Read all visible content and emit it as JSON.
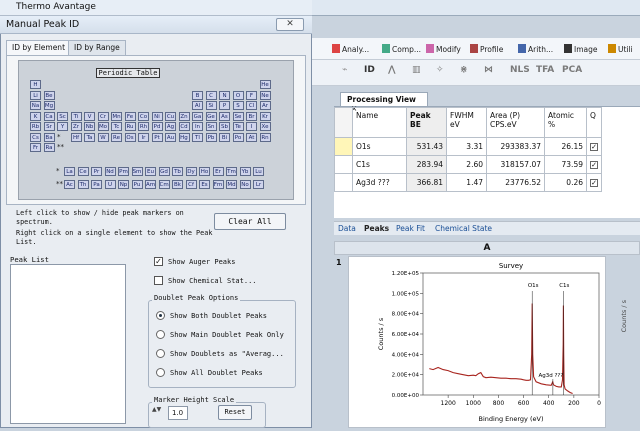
{
  "app": {
    "title": "Thermo Avantage"
  },
  "toolbar": {
    "items": [
      "Analy...",
      "Comp...",
      "Modify",
      "Profile",
      "Arith...",
      "Image",
      "Utili"
    ],
    "icons2": [
      "ID",
      "NLS",
      "TFA",
      "PCA"
    ]
  },
  "processing_view": {
    "tab_label": "Processing View",
    "close": "×",
    "columns": [
      "Name",
      "Peak BE",
      "FWHM eV",
      "Area (P) CPS.eV",
      "Atomic %",
      "Q"
    ],
    "rows": [
      {
        "name": "O1s",
        "be": "531.43",
        "fwhm": "3.31",
        "area": "293383.37",
        "atomic": "26.15",
        "q": "✓"
      },
      {
        "name": "C1s",
        "be": "283.94",
        "fwhm": "2.60",
        "area": "318157.07",
        "atomic": "73.59",
        "q": "✓"
      },
      {
        "name": "Ag3d ???",
        "be": "366.81",
        "fwhm": "1.47",
        "area": "23776.52",
        "atomic": "0.26",
        "q": "✓"
      }
    ],
    "bottom_tabs": [
      "Data",
      "Peaks",
      "Peak Fit",
      "Chemical State"
    ],
    "grid_col": "A",
    "grid_row": "1",
    "side_label": "Counts / s"
  },
  "dialog": {
    "title": "Manual Peak ID",
    "close": "✕",
    "tabs": [
      "ID by Element",
      "ID by Range"
    ],
    "pt_label": "Periodic Table",
    "help1": "Left click to show / hide peak markers on spectrum.",
    "help2": "Right click on a single element to show the Peak List.",
    "clear_all": "Clear All",
    "peak_list_label": "Peak List",
    "show_auger": "Show Auger Peaks",
    "show_auger_checked": "✓",
    "show_chemical": "Show Chemical Stat...",
    "doublet_title": "Doublet Peak Options",
    "doublet_options": [
      "Show Both Doublet Peaks",
      "Show Main Doublet Peak Only",
      "Show Doublets as \"Averag...",
      "Show All Doublet Peaks"
    ],
    "doublet_selected": 0,
    "marker_title": "Marker Height Scale",
    "marker_value": "1.0",
    "spin": "▲▼",
    "reset": "Reset"
  },
  "periodic_table": {
    "rows": [
      [
        "H",
        "",
        "",
        "",
        "",
        "",
        "",
        "",
        "",
        "",
        "",
        "",
        "",
        "",
        "",
        "",
        "",
        "He"
      ],
      [
        "Li",
        "Be",
        "",
        "",
        "",
        "",
        "",
        "",
        "",
        "",
        "",
        "",
        "B",
        "C",
        "N",
        "O",
        "F",
        "Ne"
      ],
      [
        "Na",
        "Mg",
        "",
        "",
        "",
        "",
        "",
        "",
        "",
        "",
        "",
        "",
        "Al",
        "Si",
        "P",
        "S",
        "Cl",
        "Ar"
      ],
      [
        "K",
        "Ca",
        "Sc",
        "Ti",
        "V",
        "Cr",
        "Mn",
        "Fe",
        "Co",
        "Ni",
        "Cu",
        "Zn",
        "Ga",
        "Ge",
        "As",
        "Se",
        "Br",
        "Kr"
      ],
      [
        "Rb",
        "Sr",
        "Y",
        "Zr",
        "Nb",
        "Mo",
        "Tc",
        "Ru",
        "Rh",
        "Pd",
        "Ag",
        "Cd",
        "In",
        "Sn",
        "Sb",
        "Te",
        "I",
        "Xe"
      ],
      [
        "Cs",
        "Ba",
        "*",
        "Hf",
        "Ta",
        "W",
        "Re",
        "Os",
        "Ir",
        "Pt",
        "Au",
        "Hg",
        "Tl",
        "Pb",
        "Bi",
        "Po",
        "At",
        "Rn"
      ],
      [
        "Fr",
        "Ra",
        "**",
        "",
        "",
        "",
        "",
        "",
        "",
        "",
        "",
        "",
        "",
        "",
        "",
        "",
        "",
        ""
      ]
    ],
    "lanthanides": [
      "La",
      "Ce",
      "Pr",
      "Nd",
      "Pm",
      "Sm",
      "Eu",
      "Gd",
      "Tb",
      "Dy",
      "Ho",
      "Er",
      "Tm",
      "Yb",
      "Lu"
    ],
    "actinides": [
      "Ac",
      "Th",
      "Pa",
      "U",
      "Np",
      "Pu",
      "Am",
      "Cm",
      "Bk",
      "Cf",
      "Es",
      "Fm",
      "Md",
      "No",
      "Lr"
    ],
    "star1": "*",
    "star2": "**"
  },
  "chart_data": {
    "type": "line",
    "title": "Survey",
    "xlabel": "Binding Energy (eV)",
    "ylabel": "Counts / s",
    "xlim": [
      1400,
      0
    ],
    "ylim": [
      0,
      120000
    ],
    "xticks": [
      1200,
      1000,
      800,
      600,
      400,
      200,
      0
    ],
    "yticks": [
      "0.00E+00",
      "2.00E+04",
      "4.00E+04",
      "6.00E+04",
      "8.00E+04",
      "1.00E+05",
      "1.20E+05"
    ],
    "ytick_values": [
      0,
      20000,
      40000,
      60000,
      80000,
      100000,
      120000
    ],
    "series": [
      {
        "x": [
          1350,
          1320,
          1280,
          1240,
          1200,
          1160,
          1120,
          1080,
          1040,
          1000,
          980,
          960,
          940,
          920,
          900,
          860,
          820,
          780,
          740,
          700,
          660,
          620,
          600,
          580,
          560,
          545,
          535,
          531,
          527,
          520,
          500,
          460,
          420,
          380,
          368,
          362,
          340,
          320,
          300,
          290,
          285,
          283,
          281,
          278,
          270,
          250,
          230,
          210
        ],
        "y": [
          26000,
          25000,
          27000,
          25000,
          24000,
          22000,
          21000,
          20000,
          19000,
          19500,
          19000,
          21000,
          22000,
          18000,
          17000,
          17500,
          17000,
          16500,
          16500,
          16000,
          16000,
          15500,
          15000,
          14500,
          14500,
          15000,
          40000,
          90000,
          40000,
          18000,
          13000,
          11000,
          10000,
          9500,
          13000,
          10000,
          8500,
          8000,
          8000,
          15000,
          50000,
          88000,
          40000,
          10000,
          6000,
          4000,
          2500,
          1500
        ]
      }
    ],
    "annotations": [
      "O1s",
      "C1s",
      "Ag3d ???"
    ],
    "line_color": "#a8241e"
  }
}
